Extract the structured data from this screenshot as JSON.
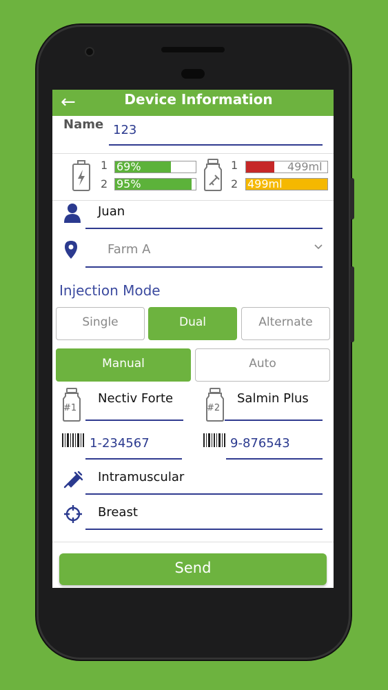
{
  "header": {
    "title": "Device Information",
    "back_icon": "arrow-left-icon"
  },
  "name": {
    "label": "Name",
    "value": "123"
  },
  "battery": {
    "icon": "battery-icon",
    "rows": [
      {
        "index": "1",
        "text": "69%",
        "level": 0.69
      },
      {
        "index": "2",
        "text": "95%",
        "level": 0.95
      }
    ]
  },
  "vials": {
    "icon": "vial-icon",
    "rows": [
      {
        "index": "1",
        "text": "499ml",
        "level": 0.35,
        "color": "#c62828"
      },
      {
        "index": "2",
        "text": "499ml",
        "level": 1.0,
        "color": "#f5b800"
      }
    ]
  },
  "user": {
    "value": "Juan",
    "icon": "person-icon"
  },
  "farm": {
    "value": "Farm A",
    "icon": "location-pin-icon"
  },
  "injection_mode": {
    "heading": "Injection Mode",
    "modes": [
      "Single",
      "Dual",
      "Alternate"
    ],
    "selected_mode": "Dual",
    "triggers": [
      "Manual",
      "Auto"
    ],
    "selected_trigger": "Manual"
  },
  "products": [
    {
      "tag": "#1",
      "name": "Nectiv Forte",
      "barcode": "1-234567"
    },
    {
      "tag": "#2",
      "name": "Salmin Plus",
      "barcode": "9-876543"
    }
  ],
  "route": {
    "value": "Intramuscular",
    "icon": "syringe-icon"
  },
  "site": {
    "value": "Breast",
    "icon": "crosshair-icon"
  },
  "send_label": "Send",
  "colors": {
    "accent": "#6db33f",
    "field_text": "#2b3a8f"
  }
}
